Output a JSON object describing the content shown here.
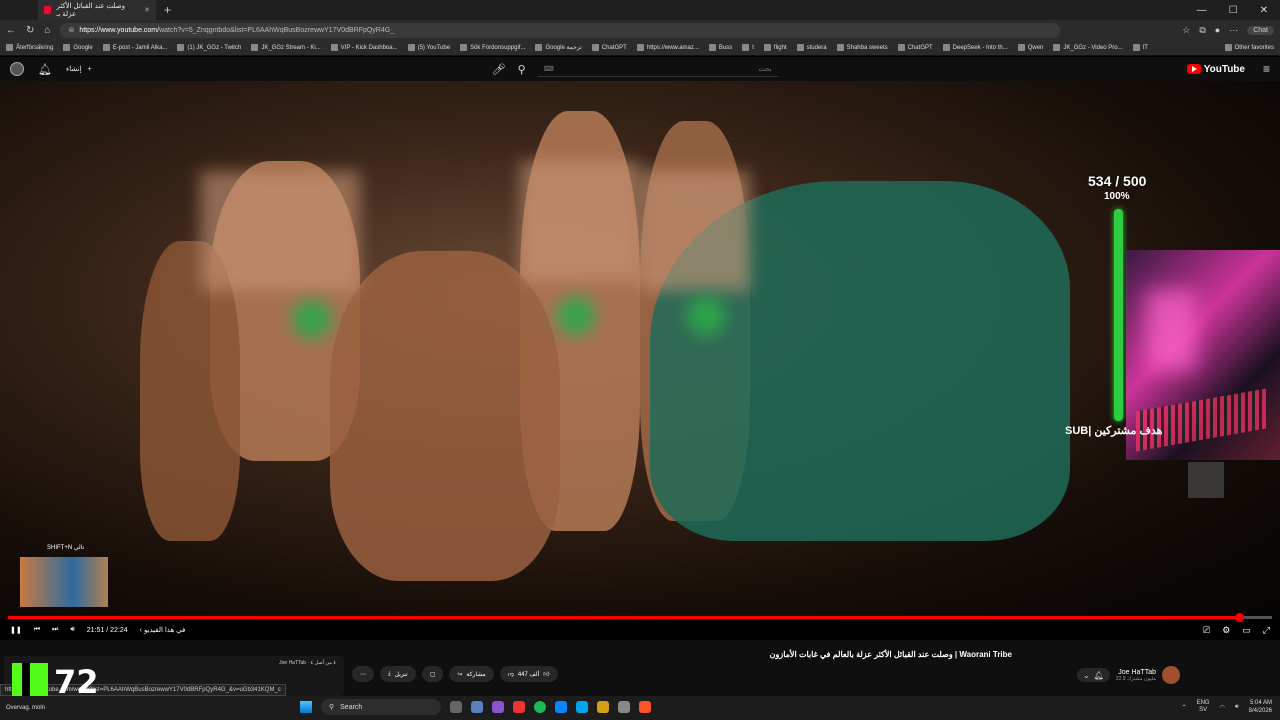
{
  "browser": {
    "tab_title": "وصلت عند القبائل الأكثر عزلة بـ",
    "url_prefix": "https://www.youtube.com/",
    "url_rest": "watch?v=5_Znqgntbdo&list=PL6AAhWqBusBozrewwY17V0dBRFpQyR4G_",
    "chat_label": "Chat",
    "bookmarks": [
      "Återförsäkring",
      "Google",
      "E-post - Jamil Alka...",
      "(1) JK_GGz - Twitch",
      "JK_GGz Stream - Ki...",
      "VIP - Kick Dashboa...",
      "(5) YouTube",
      "Sök Fordonsuppgif...",
      "Google ترجمة",
      "ChatGPT",
      "https://www.amaz...",
      "Buss",
      "t",
      "flight",
      "studera",
      "Shahba sweets",
      "ChatGPT",
      "DeepSeek - Into th...",
      "Qwen",
      "JK_GGz - Video Pro...",
      "IT"
    ],
    "other_favorites": "Other favorites"
  },
  "youtube": {
    "create_label": "إنشاء",
    "search_placeholder": "بحث",
    "logo_text": "YouTube"
  },
  "overlay": {
    "goal_count": "534 / 500",
    "goal_percent": "100%",
    "goal_label": "SUB| هدف مشتركين",
    "next_label": "SHIFT+N",
    "next_prefix": "تالي"
  },
  "player": {
    "progress": 0.978,
    "time": "21:51 / 22:24",
    "chapter": "‹ في هذا الفيديو"
  },
  "video_info": {
    "title": "وصلت عند القبائل الأكثر عزلة بالعالم في غابات الأمازون | Waorani Tribe",
    "channel": "Joe HaTTab",
    "subscribers": "22.9 مليون مشترك",
    "likes": "447 ألف",
    "share": "مشاركة",
    "download": "تنزيل",
    "playlist_channel": "Joe HaTTab",
    "playlist_meta": "٤ من أصل ٤"
  },
  "status_url": "https://www.youtube.com/watch?list=PL6AAhWqBusBozrewwY17V0dBRFpQyR4G_&v=uGb341KQM_c",
  "stream_overlay": {
    "viewers": "72"
  },
  "taskbar": {
    "weather": [
      "Overvag. moln"
    ],
    "search_label": "Search",
    "lang_1": "ENG",
    "lang_2": "SV",
    "time": "5:04 AM",
    "date": "8/4/2026"
  }
}
